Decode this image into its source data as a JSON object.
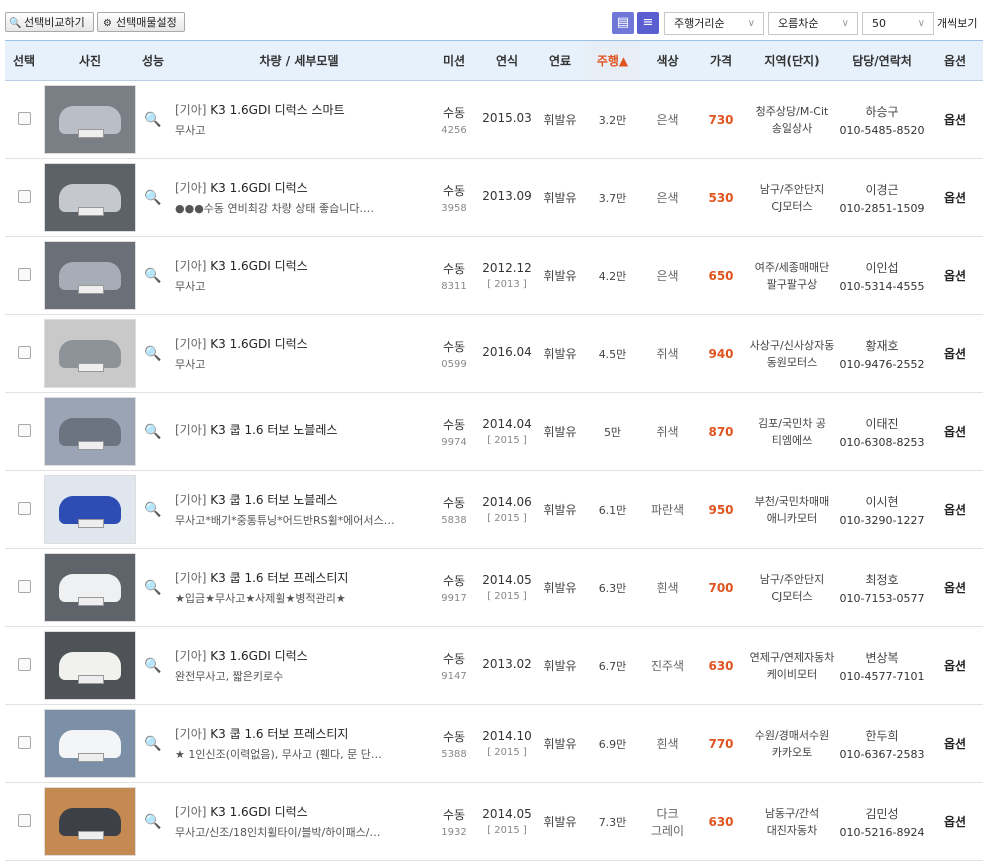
{
  "toolbar": {
    "compare_label": "선택비교하기",
    "settings_label": "선택매물설정",
    "sort_options": [
      {
        "value": "주행거리순"
      },
      {
        "value": "오름차순"
      },
      {
        "value": "50"
      }
    ],
    "per_view_label": "개씩보기"
  },
  "colors": {
    "header_bg": "#e6f1fb",
    "accent": "#e0541f",
    "view_button": "#6f78d9"
  },
  "table": {
    "headers": [
      "선택",
      "사진",
      "성능",
      "차량 / 세부모델",
      "미션",
      "연식",
      "연료",
      "주행▲",
      "색상",
      "가격",
      "지역(단지)",
      "담당/연락처",
      "옵션"
    ],
    "rows": [
      {
        "brand": "[기아]",
        "model": "K3 1.6GDI 디럭스 스마트",
        "desc": "무사고",
        "mission": "수동",
        "mission_code": "4256",
        "year": "2015.03",
        "reg_year": "",
        "fuel": "휘발유",
        "mileage": "3.2만",
        "color": "은색",
        "price": "730",
        "region1": "청주상당/M-Cit",
        "region2": "송일상사",
        "name": "하승구",
        "phone": "010-5485-8520",
        "option": "옵션",
        "car_color": "#b9bec7",
        "bg": "#7a7f85"
      },
      {
        "brand": "[기아]",
        "model": "K3 1.6GDI 디럭스",
        "desc": "●●●수동 연비최강 차량 상태 좋습니다.…",
        "mission": "수동",
        "mission_code": "3958",
        "year": "2013.09",
        "reg_year": "",
        "fuel": "휘발유",
        "mileage": "3.7만",
        "color": "은색",
        "price": "530",
        "region1": "남구/주안단지",
        "region2": "CJ모터스",
        "name": "이경근",
        "phone": "010-2851-1509",
        "option": "옵션",
        "car_color": "#c5c9cf",
        "bg": "#5d6168"
      },
      {
        "brand": "[기아]",
        "model": "K3 1.6GDI 디럭스",
        "desc": "무사고",
        "mission": "수동",
        "mission_code": "8311",
        "year": "2012.12",
        "reg_year": "[ 2013 ]",
        "fuel": "휘발유",
        "mileage": "4.2만",
        "color": "은색",
        "price": "650",
        "region1": "여주/세종매매단",
        "region2": "팔구팔구상",
        "name": "이인섭",
        "phone": "010-5314-4555",
        "option": "옵션",
        "car_color": "#a6adb6",
        "bg": "#6b7078"
      },
      {
        "brand": "[기아]",
        "model": "K3 1.6GDI 디럭스",
        "desc": "무사고",
        "mission": "수동",
        "mission_code": "0599",
        "year": "2016.04",
        "reg_year": "",
        "fuel": "휘발유",
        "mileage": "4.5만",
        "color": "쥐색",
        "price": "940",
        "region1": "사상구/신사상자동",
        "region2": "동원모터스",
        "name": "황재호",
        "phone": "010-9476-2552",
        "option": "옵션",
        "car_color": "#8e939a",
        "bg": "#c9c9c9"
      },
      {
        "brand": "[기아]",
        "model": "K3 쿱 1.6 터보 노블레스",
        "desc": "",
        "mission": "수동",
        "mission_code": "9974",
        "year": "2014.04",
        "reg_year": "[ 2015 ]",
        "fuel": "휘발유",
        "mileage": "5만",
        "color": "쥐색",
        "price": "870",
        "region1": "김포/국민차 공",
        "region2": "티엠에쓰",
        "name": "이태진",
        "phone": "010-6308-8253",
        "option": "옵션",
        "car_color": "#6c7482",
        "bg": "#9aa4b4"
      },
      {
        "brand": "[기아]",
        "model": "K3 쿱 1.6 터보 노블레스",
        "desc": "무사고*배기*중통튜닝*어드반RS휠*에어서스…",
        "mission": "수동",
        "mission_code": "5838",
        "year": "2014.06",
        "reg_year": "[ 2015 ]",
        "fuel": "휘발유",
        "mileage": "6.1만",
        "color": "파란색",
        "price": "950",
        "region1": "부천/국민차매매",
        "region2": "애니카모터",
        "name": "이시현",
        "phone": "010-3290-1227",
        "option": "옵션",
        "car_color": "#2d4db5",
        "bg": "#dfe6ee"
      },
      {
        "brand": "[기아]",
        "model": "K3 쿱 1.6 터보 프레스티지",
        "desc": "★입금★무사고★사제휠★병적관리★",
        "mission": "수동",
        "mission_code": "9917",
        "year": "2014.05",
        "reg_year": "[ 2015 ]",
        "fuel": "휘발유",
        "mileage": "6.3만",
        "color": "흰색",
        "price": "700",
        "region1": "남구/주안단지",
        "region2": "CJ모터스",
        "name": "최정호",
        "phone": "010-7153-0577",
        "option": "옵션",
        "car_color": "#eef0f2",
        "bg": "#5f646b"
      },
      {
        "brand": "[기아]",
        "model": "K3 1.6GDI 디럭스",
        "desc": "완전무사고, 짧은키로수",
        "mission": "수동",
        "mission_code": "9147",
        "year": "2013.02",
        "reg_year": "",
        "fuel": "휘발유",
        "mileage": "6.7만",
        "color": "진주색",
        "price": "630",
        "region1": "연제구/연제자동차",
        "region2": "케이비모터",
        "name": "변상복",
        "phone": "010-4577-7101",
        "option": "옵션",
        "car_color": "#f1f1ee",
        "bg": "#4f5358"
      },
      {
        "brand": "[기아]",
        "model": "K3 쿱 1.6 터보 프레스티지",
        "desc": "★ 1인신조(이력없음), 무사고 (휀다, 문 단…",
        "mission": "수동",
        "mission_code": "5388",
        "year": "2014.10",
        "reg_year": "[ 2015 ]",
        "fuel": "휘발유",
        "mileage": "6.9만",
        "color": "흰색",
        "price": "770",
        "region1": "수원/경매서수원",
        "region2": "카카오토",
        "name": "한두희",
        "phone": "010-6367-2583",
        "option": "옵션",
        "car_color": "#f4f5f7",
        "bg": "#7b8fa6"
      },
      {
        "brand": "[기아]",
        "model": "K3 1.6GDI 디럭스",
        "desc": "무사고/신조/18인치휠타이/블박/하이패스/…",
        "mission": "수동",
        "mission_code": "1932",
        "year": "2014.05",
        "reg_year": "[ 2015 ]",
        "fuel": "휘발유",
        "mileage": "7.3만",
        "color": "다크\n그레이",
        "price": "630",
        "region1": "남동구/간석",
        "region2": "대진자동차",
        "name": "김민성",
        "phone": "010-5216-8924",
        "option": "옵션",
        "car_color": "#3d4046",
        "bg": "#c48a52"
      }
    ]
  }
}
